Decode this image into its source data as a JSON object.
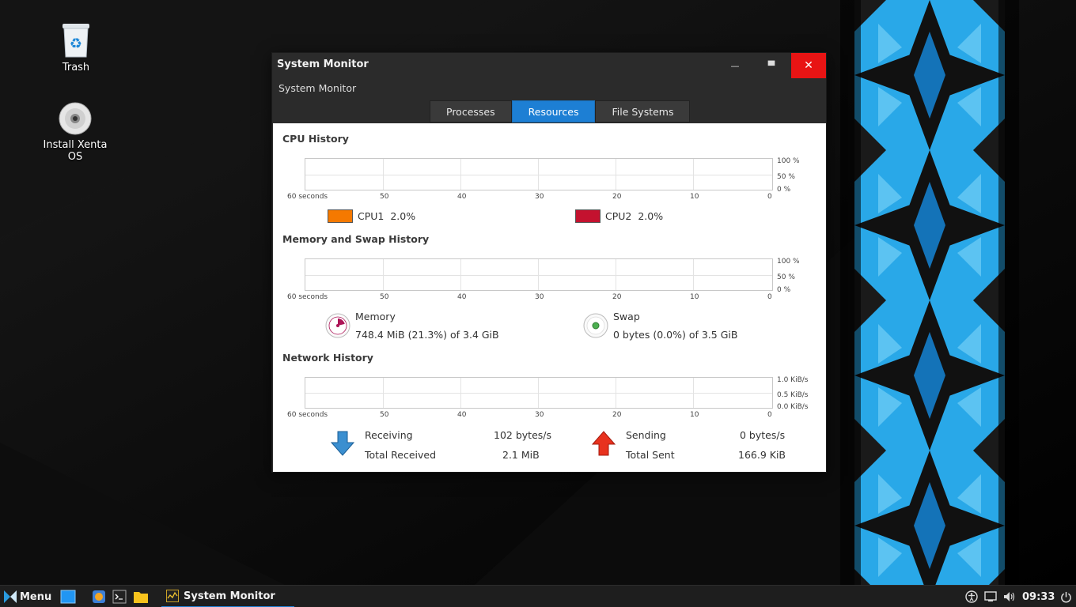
{
  "desktop": {
    "icons": [
      {
        "label": "Trash",
        "icon": "trash-icon"
      },
      {
        "label": "Install Xenta OS",
        "icon": "disc-icon"
      }
    ]
  },
  "window": {
    "title": "System Monitor",
    "subtitle": "System Monitor",
    "controls": {
      "minimize": "—",
      "maximize": "▀",
      "close": "✕"
    },
    "tabs": [
      {
        "label": "Processes",
        "active": false
      },
      {
        "label": "Resources",
        "active": true
      },
      {
        "label": "File Systems",
        "active": false
      }
    ],
    "accent_color": "#1d7fd4",
    "close_color": "#e81414"
  },
  "resources": {
    "x_ticks": [
      "60 seconds",
      "50",
      "40",
      "30",
      "20",
      "10",
      "0"
    ],
    "cpu": {
      "title": "CPU History",
      "y_labels": [
        "100 %",
        "50 %",
        "0 %"
      ],
      "legend": [
        {
          "label": "CPU1",
          "value": "2.0%",
          "color": "#f57900"
        },
        {
          "label": "CPU2",
          "value": "2.0%",
          "color": "#c4122f"
        }
      ]
    },
    "memory": {
      "title": "Memory and Swap History",
      "y_labels": [
        "100 %",
        "50 %",
        "0 %"
      ],
      "memory_label": "Memory",
      "memory_value": "748.4 MiB (21.3%) of 3.4 GiB",
      "memory_fraction": 0.213,
      "memory_color": "#ad1457",
      "swap_label": "Swap",
      "swap_value": "0 bytes (0.0%) of 3.5 GiB",
      "swap_color": "#4caf50"
    },
    "network": {
      "title": "Network History",
      "y_labels": [
        "1.0 KiB/s",
        "0.5 KiB/s",
        "0.0 KiB/s"
      ],
      "receiving_label": "Receiving",
      "receiving_value": "102 bytes/s",
      "total_received_label": "Total Received",
      "total_received_value": "2.1 MiB",
      "sending_label": "Sending",
      "sending_value": "0 bytes/s",
      "total_sent_label": "Total Sent",
      "total_sent_value": "166.9 KiB"
    }
  },
  "taskbar": {
    "menu_label": "Menu",
    "launchers": [
      "show-desktop-icon",
      "browser-icon",
      "terminal-icon",
      "files-icon"
    ],
    "active_task": "System Monitor",
    "tray": [
      "accessibility-icon",
      "network-icon",
      "volume-icon"
    ],
    "clock": "09:33",
    "power": "power-icon"
  }
}
